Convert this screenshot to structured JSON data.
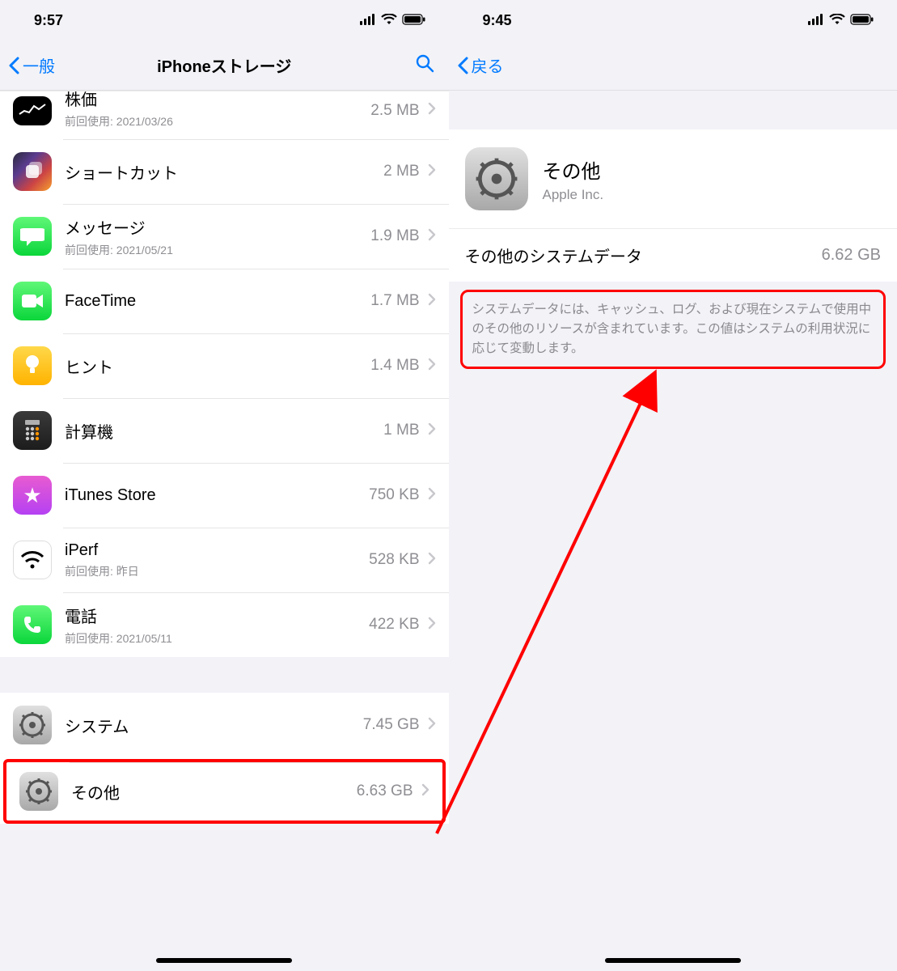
{
  "left": {
    "status_time": "9:57",
    "nav_back": "一般",
    "nav_title": "iPhoneストレージ",
    "last_used_prefix": "前回使用:",
    "apps": [
      {
        "name": "株価",
        "size": "2.5 MB",
        "last_used": "2021/03/26",
        "icon": "stocks"
      },
      {
        "name": "ショートカット",
        "size": "2 MB",
        "last_used": "",
        "icon": "shortcuts"
      },
      {
        "name": "メッセージ",
        "size": "1.9 MB",
        "last_used": "2021/05/21",
        "icon": "messages"
      },
      {
        "name": "FaceTime",
        "size": "1.7 MB",
        "last_used": "",
        "icon": "facetime"
      },
      {
        "name": "ヒント",
        "size": "1.4 MB",
        "last_used": "",
        "icon": "tips"
      },
      {
        "name": "計算機",
        "size": "1 MB",
        "last_used": "",
        "icon": "calculator"
      },
      {
        "name": "iTunes Store",
        "size": "750 KB",
        "last_used": "",
        "icon": "itunes"
      },
      {
        "name": "iPerf",
        "size": "528 KB",
        "last_used": "昨日",
        "icon": "iperf"
      },
      {
        "name": "電話",
        "size": "422 KB",
        "last_used": "2021/05/11",
        "icon": "phone"
      }
    ],
    "system": [
      {
        "name": "システム",
        "size": "7.45 GB"
      },
      {
        "name": "その他",
        "size": "6.63 GB"
      }
    ]
  },
  "right": {
    "status_time": "9:45",
    "nav_back": "戻る",
    "detail_title": "その他",
    "detail_sub": "Apple Inc.",
    "row_label": "その他のシステムデータ",
    "row_size": "6.62 GB",
    "footnote": "システムデータには、キャッシュ、ログ、および現在システムで使用中のその他のリソースが含まれています。この値はシステムの利用状況に応じて変動します。"
  }
}
